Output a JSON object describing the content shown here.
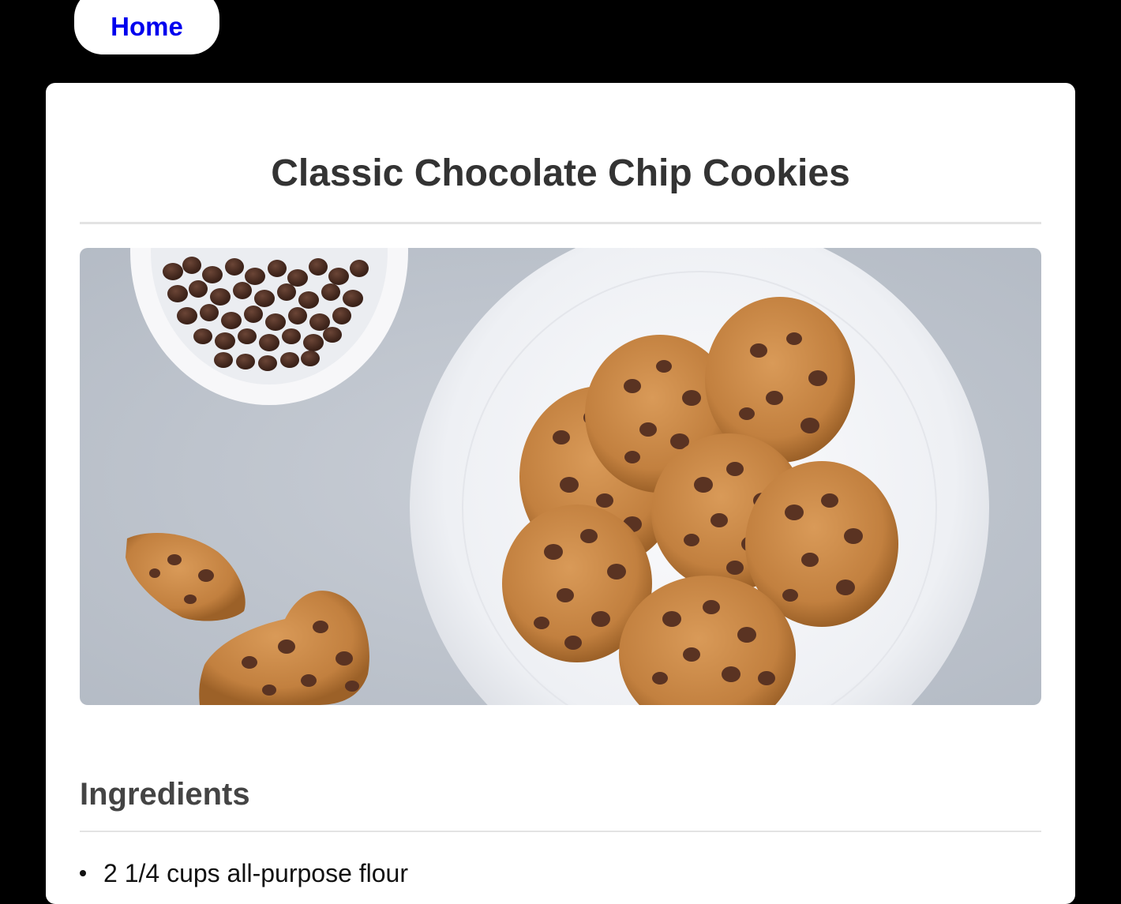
{
  "nav": {
    "home_label": "Home"
  },
  "recipe": {
    "title": "Classic Chocolate Chip Cookies",
    "hero_image": {
      "alt": "Plate of chocolate chip cookies with a bowl of chocolate chips"
    },
    "ingredients_heading": "Ingredients",
    "ingredients": [
      "2 1/4 cups all-purpose flour"
    ]
  },
  "colors": {
    "page_background": "#000000",
    "card_background": "#ffffff",
    "link": "#0000ee",
    "title_text": "#333333",
    "divider": "#e3e3e3"
  }
}
